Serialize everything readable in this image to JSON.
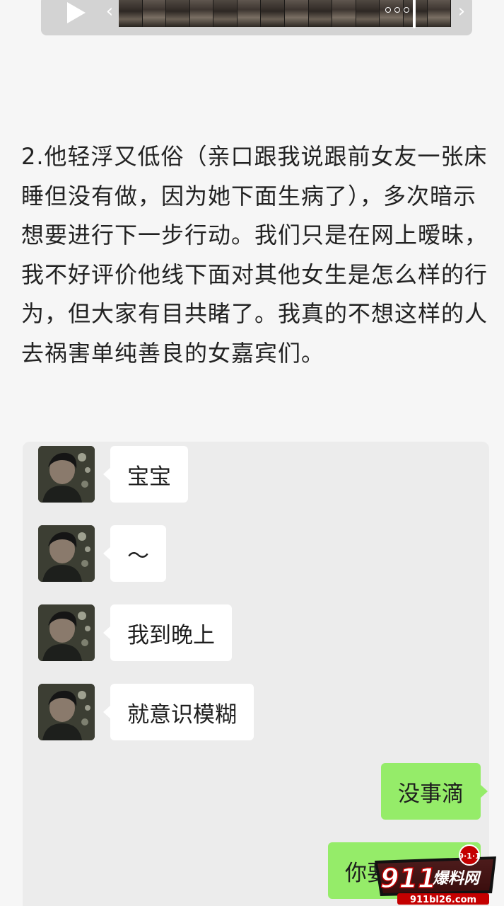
{
  "video_bar": {
    "play_icon": "play-icon",
    "trim_left": "‹",
    "trim_right": "›"
  },
  "article": {
    "paragraph": "2.他轻浮又低俗（亲口跟我说跟前女友一张床睡但没有做，因为她下面生病了），多次暗示想要进行下一步行动。我们只是在网上暧昧，我不好评价他线下面对其他女生是怎么样的行为，但大家有目共睹了。我真的不想这样的人去祸害单纯善良的女嘉宾们。"
  },
  "chat": {
    "messages": [
      {
        "side": "left",
        "text": "宝宝"
      },
      {
        "side": "left",
        "text": "～"
      },
      {
        "side": "left",
        "text": "我到晚上"
      },
      {
        "side": "left",
        "text": "就意识模糊"
      },
      {
        "side": "right",
        "text": "没事滴"
      },
      {
        "side": "right",
        "text": "你要"
      }
    ],
    "colors": {
      "panel": "#ececec",
      "incoming_bubble": "#ffffff",
      "outgoing_bubble": "#95ec69"
    }
  },
  "watermark": {
    "text": "911爆料网",
    "badge": "9·1·1",
    "url": "911bl26.com"
  }
}
